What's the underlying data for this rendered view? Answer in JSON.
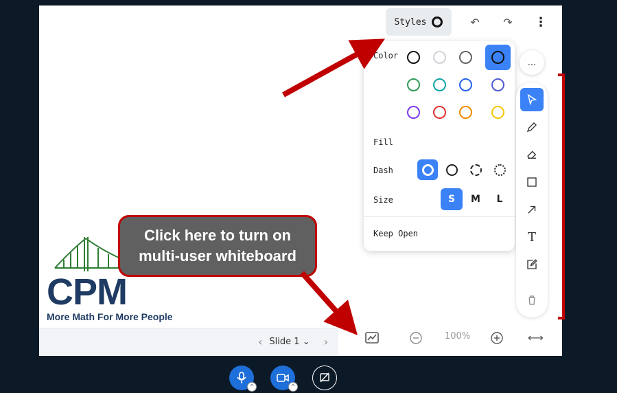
{
  "toolbar": {
    "styles_label": "Styles",
    "undo_icon": "undo-icon",
    "redo_icon": "redo-icon",
    "more_icon": "more-vertical-icon"
  },
  "panel": {
    "color_label": "Color",
    "fill_label": "Fill",
    "dash_label": "Dash",
    "size_label": "Size",
    "keep_open_label": "Keep Open",
    "colors": [
      "#111111",
      "#cfd2d6",
      "#666666",
      "#111111",
      "#2e9b57",
      "#0ea5a4",
      "#2563eb",
      "#4f5bd5",
      "#7c3aed",
      "#e03131",
      "#f08c00",
      "#f6c700"
    ],
    "selected_color_index": 3,
    "size_options": [
      "S",
      "M",
      "L"
    ],
    "selected_size": "S"
  },
  "side_tools": {
    "more_label": "...",
    "items": [
      "select-icon",
      "pencil-icon",
      "eraser-icon",
      "rectangle-icon",
      "arrow-icon",
      "text-icon",
      "note-icon"
    ],
    "delete_icon": "trash-icon"
  },
  "slide": {
    "logo_text": "CPM",
    "tagline": "More Math For More People",
    "nav_label": "Slide 1"
  },
  "bottom_bar": {
    "zoom_label": "100%"
  },
  "annotation": {
    "line1": "Click here to turn on",
    "line2": "multi-user whiteboard"
  },
  "colors": {
    "accent": "#3b82f6",
    "annotation_red": "#c00000",
    "background": "#0c1927"
  }
}
